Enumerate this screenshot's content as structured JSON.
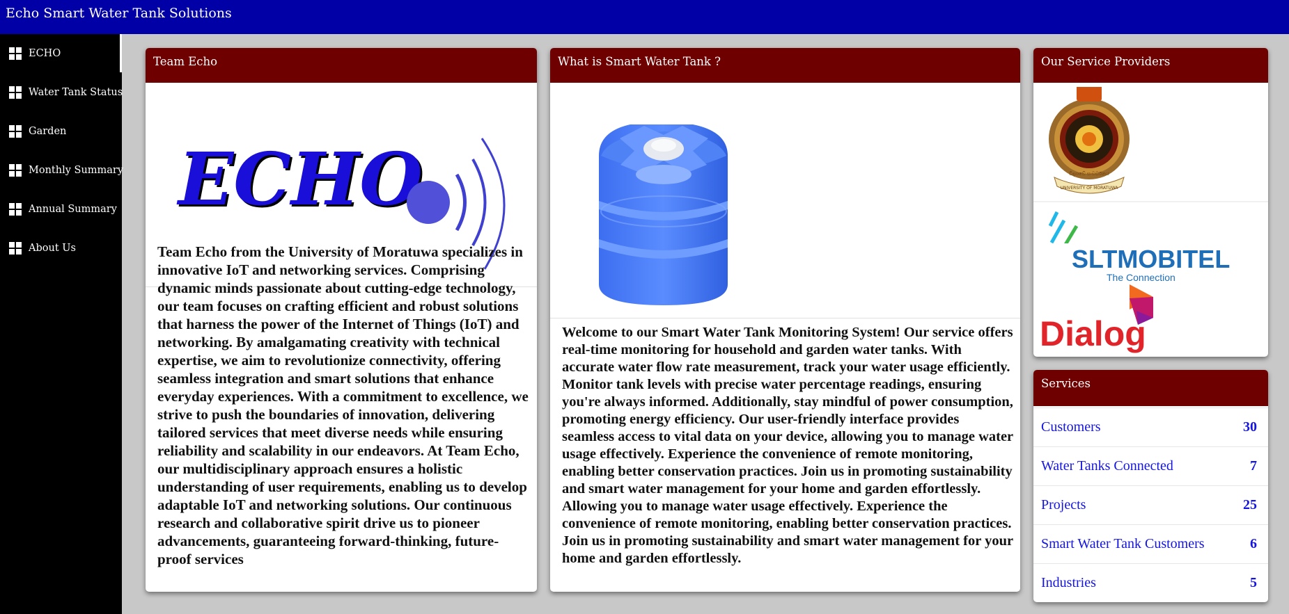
{
  "app": {
    "title": "Echo Smart Water Tank Solutions"
  },
  "sidebar": {
    "items": [
      {
        "label": "ECHO",
        "icon": "dashboard-icon"
      },
      {
        "label": "Water Tank Status",
        "icon": "dashboard-icon"
      },
      {
        "label": "Garden",
        "icon": "dashboard-icon"
      },
      {
        "label": "Monthly Summary",
        "icon": "dashboard-icon"
      },
      {
        "label": "Annual Summary",
        "icon": "dashboard-icon"
      },
      {
        "label": "About Us",
        "icon": "dashboard-icon"
      }
    ]
  },
  "team": {
    "header": "Team Echo",
    "logo_text": "ECHO",
    "text": "Team Echo from the University of Moratuwa specializes in innovative IoT and networking services. Comprising dynamic minds passionate about cutting-edge technology, our team focuses on crafting efficient and robust solutions that harness the power of the Internet of Things (IoT) and networking. By amalgamating creativity with technical expertise, we aim to revolutionize connectivity, offering seamless integration and smart solutions that enhance everyday experiences. With a commitment to excellence, we strive to push the boundaries of innovation, delivering tailored services that meet diverse needs while ensuring reliability and scalability in our endeavors. At Team Echo, our multidisciplinary approach ensures a holistic understanding of user requirements, enabling us to develop adaptable IoT and networking solutions. Our continuous research and collaborative spirit drive us to pioneer advancements, guaranteeing forward-thinking, future-proof services"
  },
  "smart_tank": {
    "header": "What is Smart Water Tank ?",
    "text": "Welcome to our Smart Water Tank Monitoring System! Our service offers real-time monitoring for household and garden water tanks. With accurate water flow rate measurement, track your water usage efficiently. Monitor tank levels with precise water percentage readings, ensuring you're always informed. Additionally, stay mindful of power consumption, promoting energy efficiency. Our user-friendly interface provides seamless access to vital data on your device, allowing you to manage water usage effectively. Experience the convenience of remote monitoring, enabling better conservation practices. Join us in promoting sustainability and smart water management for your home and garden effortlessly. Allowing you to manage water usage effectively. Experience the convenience of remote monitoring, enabling better conservation practices. Join us in promoting sustainability and smart water management for your home and garden effortlessly."
  },
  "providers": {
    "header": "Our Service Providers",
    "uom_caption": "UNIVERSITY OF MORATUWA",
    "uom_motto": "විද්‍යාවේ සංවර්ධනය",
    "slt_name": "SLTMOBITEL",
    "slt_tagline": "The Connection",
    "dialog_name": "Dialog"
  },
  "services": {
    "header": "Services",
    "rows": [
      {
        "name": "Customers",
        "value": "30"
      },
      {
        "name": "Water Tanks Connected",
        "value": "7"
      },
      {
        "name": "Projects",
        "value": "25"
      },
      {
        "name": "Smart Water Tank Customers",
        "value": "6"
      },
      {
        "name": "Industries",
        "value": "5"
      }
    ]
  },
  "colors": {
    "topbar": "#0000a6",
    "card_header": "#6e0000",
    "link": "#1515e0"
  }
}
